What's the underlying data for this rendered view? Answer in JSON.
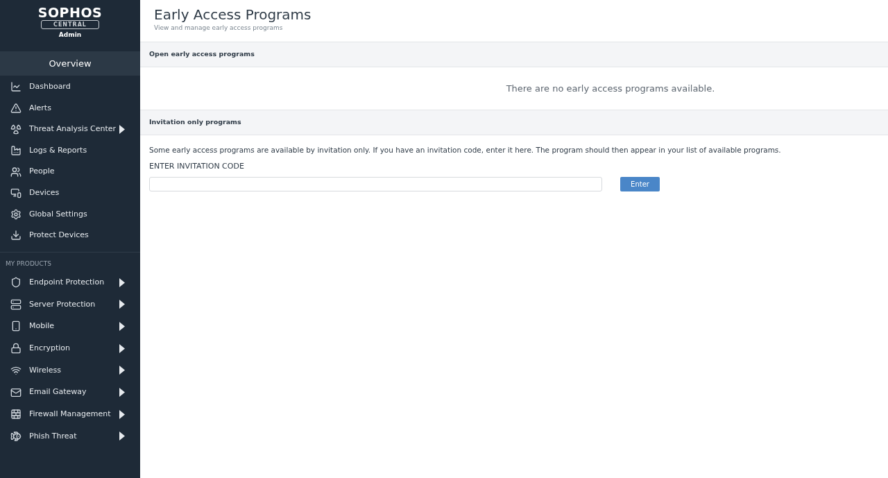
{
  "sidebar": {
    "logo": {
      "brand": "SOPHOS",
      "product": "CENTRAL",
      "role": "Admin"
    },
    "overview": {
      "title": "Overview",
      "selected": true
    },
    "items": [
      {
        "label": "Dashboard",
        "has_submenu": false
      },
      {
        "label": "Alerts",
        "has_submenu": false
      },
      {
        "label": "Threat Analysis Center",
        "has_submenu": true
      },
      {
        "label": "Logs & Reports",
        "has_submenu": false
      },
      {
        "label": "People",
        "has_submenu": false
      },
      {
        "label": "Devices",
        "has_submenu": false
      },
      {
        "label": "Global Settings",
        "has_submenu": false
      },
      {
        "label": "Protect Devices",
        "has_submenu": false
      }
    ],
    "products_heading": "MY PRODUCTS",
    "products": [
      {
        "label": "Endpoint Protection",
        "has_submenu": true
      },
      {
        "label": "Server Protection",
        "has_submenu": true
      },
      {
        "label": "Mobile",
        "has_submenu": true
      },
      {
        "label": "Encryption",
        "has_submenu": true
      },
      {
        "label": "Wireless",
        "has_submenu": true
      },
      {
        "label": "Email Gateway",
        "has_submenu": true
      },
      {
        "label": "Firewall Management",
        "has_submenu": true
      },
      {
        "label": "Phish Threat",
        "has_submenu": true
      }
    ]
  },
  "page": {
    "title": "Early Access Programs",
    "subtitle": "View and manage early access programs"
  },
  "open_section": {
    "heading": "Open early access programs",
    "empty_message": "There are no early access programs available."
  },
  "invitation_section": {
    "heading": "Invitation only programs",
    "description": "Some early access programs are available by invitation only. If you have an invitation code, enter it here. The program should then appear in your list of available programs.",
    "field_label": "ENTER INVITATION CODE",
    "button": "Enter"
  }
}
